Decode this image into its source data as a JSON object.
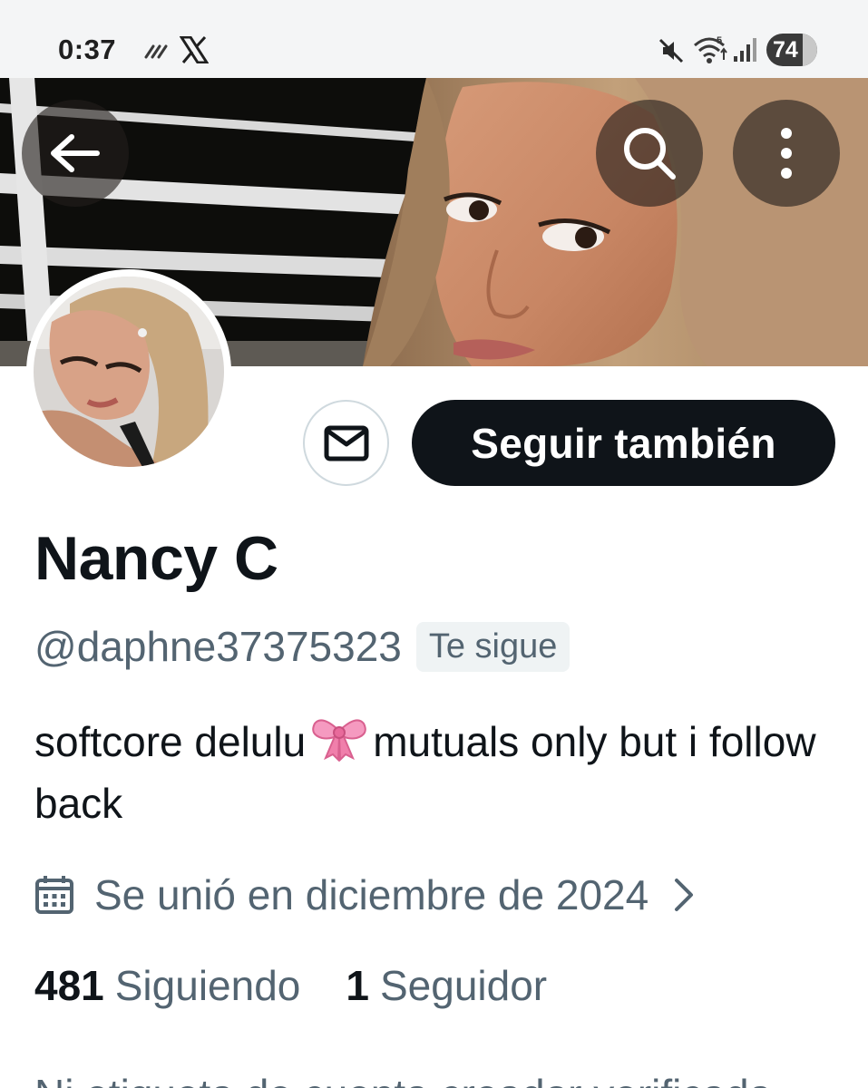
{
  "status_bar": {
    "time": "0:37",
    "battery": "74",
    "icons": [
      "voicemail-icon",
      "x-logo-icon",
      "mute-icon",
      "wifi-icon",
      "signal-icon",
      "battery-icon"
    ]
  },
  "header": {
    "back_icon": "arrow-left-icon",
    "search_icon": "search-icon",
    "more_icon": "more-vertical-icon"
  },
  "profile": {
    "display_name": "Nancy C",
    "handle": "@daphne37375323",
    "follows_you_badge": "Te sigue",
    "bio_part1": "softcore delulu",
    "bio_emoji": "ribbon-bow-emoji",
    "bio_part2": "mutuals only but i follow back",
    "joined": "Se unió en diciembre de 2024",
    "following_count": "481",
    "following_label": "Siguiendo",
    "followers_count": "1",
    "followers_label": "Seguidor",
    "cut_off_text": "Ni etiqueta de cuenta creador verificada"
  },
  "actions": {
    "message_icon": "envelope-icon",
    "follow_label": "Seguir también"
  },
  "colors": {
    "primary_text": "#0f1419",
    "secondary_text": "#536471",
    "button_dark": "#0f1419",
    "badge_bg": "#eff3f4",
    "border": "#cfd9de"
  }
}
